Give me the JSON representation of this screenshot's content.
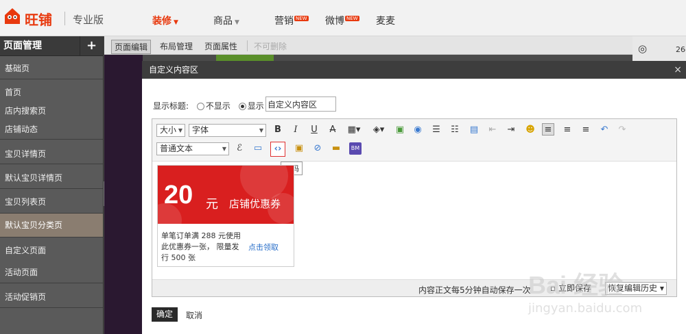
{
  "topnav": {
    "brand": "旺铺",
    "edition": "专业版",
    "items": [
      {
        "label": "装修",
        "caret": "▼",
        "active": true
      },
      {
        "label": "商品",
        "caret": "▼"
      },
      {
        "label": "营销",
        "badge": "NEW"
      },
      {
        "label": "微博",
        "badge": "NEW"
      },
      {
        "label": "麦麦"
      }
    ]
  },
  "sidebar": {
    "title": "页面管理",
    "add": "+",
    "items": [
      {
        "label": "基础页"
      },
      {
        "label": "首页"
      },
      {
        "label": "店内搜索页"
      },
      {
        "label": "店铺动态"
      },
      {
        "label": "宝贝详情页"
      },
      {
        "label": "默认宝贝详情页"
      },
      {
        "label": "宝贝列表页"
      },
      {
        "label": "默认宝贝分类页",
        "active": true
      },
      {
        "label": "自定义页面"
      },
      {
        "label": "活动页面"
      },
      {
        "label": "活动促销页"
      }
    ]
  },
  "editor_tabs": {
    "items": [
      "页面编辑",
      "布局管理",
      "页面属性",
      "不可删除"
    ]
  },
  "right_strip": {
    "number": "26-"
  },
  "modal": {
    "title": "自定义内容区",
    "close": "×",
    "show_title_label": "显示标题:",
    "option_hide": "不显示",
    "option_show": "显示",
    "title_value": "自定义内容区",
    "toolbar": {
      "size_select": "大小",
      "font_select": "字体",
      "format_select": "普通文本",
      "source_tooltip": "源码"
    },
    "coupon": {
      "amount": "20",
      "unit": "元",
      "label": "店铺优惠券",
      "desc": "单笔订单满 288 元使用此优惠券一张， 限量发行 500 张",
      "link": "点击领取"
    },
    "status": {
      "autosave": "内容正文每5分钟自动保存一次",
      "save_now": "立即保存",
      "restore": "恢复编辑历史"
    },
    "ok": "确定",
    "cancel": "取消"
  },
  "watermark": {
    "text": "Bai 经验",
    "url": "jingyan.baidu.com"
  },
  "colors": {
    "brand": "#e8390e",
    "coupon_red": "#d91f1f",
    "link": "#2a6fc9"
  }
}
